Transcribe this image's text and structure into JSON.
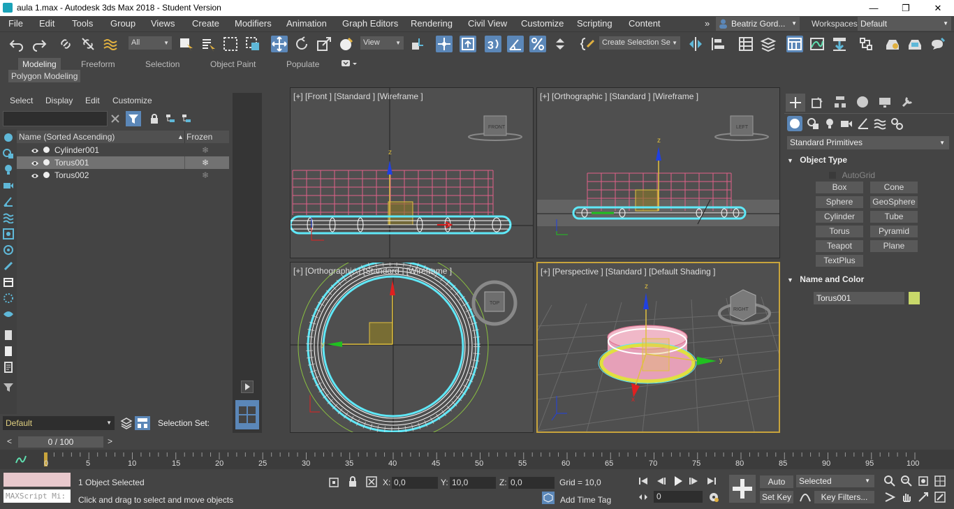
{
  "window": {
    "title": "aula 1.max - Autodesk 3ds Max 2018 - Student Version",
    "minimize": "—",
    "restore": "❐",
    "close": "✕"
  },
  "menu": {
    "items": [
      "File",
      "Edit",
      "Tools",
      "Group",
      "Views",
      "Create",
      "Modifiers",
      "Animation",
      "Graph Editors",
      "Rendering",
      "Civil View",
      "Customize",
      "Scripting",
      "Content"
    ],
    "overflow": "»",
    "user": "Beatriz Gord...",
    "workspaces_label": "Workspaces:",
    "workspace_value": "Default"
  },
  "toolbar": {
    "filter_value": "All",
    "refcoord_value": "View",
    "selection_set_value": "Create Selection Se"
  },
  "ribbon": {
    "tabs": [
      "Modeling",
      "Freeform",
      "Selection",
      "Object Paint",
      "Populate"
    ],
    "sub_label": "Polygon Modeling"
  },
  "explorer": {
    "menus": [
      "Select",
      "Display",
      "Edit",
      "Customize"
    ],
    "col_name": "Name (Sorted Ascending)",
    "col_frozen": "Frozen",
    "sort_arrow": "▲",
    "rows": [
      {
        "name": "Cylinder001",
        "selected": false
      },
      {
        "name": "Torus001",
        "selected": true
      },
      {
        "name": "Torus002",
        "selected": false
      }
    ],
    "layer_value": "Default",
    "selection_set_label": "Selection Set:"
  },
  "viewports": {
    "front": "[+] [Front ] [Standard ] [Wireframe ]",
    "ortho_top_right": "[+] [Orthographic ] [Standard ] [Wireframe ]",
    "ortho_bottom_left": "[+] [Orthographic ] [Standard ] [Wireframe ]",
    "perspective": "[+] [Perspective ] [Standard ] [Default Shading ]",
    "viewcube_front": "FRONT",
    "viewcube_left": "LEFT",
    "viewcube_top": "TOP",
    "viewcube_right": "RIGHT",
    "axis_x": "x",
    "axis_y": "y",
    "axis_z": "z"
  },
  "command_panel": {
    "category_value": "Standard Primitives",
    "object_type_title": "Object Type",
    "autogrid_label": "AutoGrid",
    "buttons": [
      "Box",
      "Cone",
      "Sphere",
      "GeoSphere",
      "Cylinder",
      "Tube",
      "Torus",
      "Pyramid",
      "Teapot",
      "Plane",
      "TextPlus"
    ],
    "name_color_title": "Name and Color",
    "object_name": "Torus001",
    "object_color": "#c8d86a"
  },
  "timeline": {
    "frame_display": "0 / 100",
    "prev": "<",
    "next": ">",
    "ticks": [
      "0",
      "5",
      "10",
      "15",
      "20",
      "25",
      "30",
      "35",
      "40",
      "45",
      "50",
      "55",
      "60",
      "65",
      "70",
      "75",
      "80",
      "85",
      "90",
      "95",
      "100"
    ]
  },
  "status": {
    "maxscript_placeholder": "MAXScript Mi:",
    "objects_selected": "1 Object Selected",
    "prompt": "Click and drag to select and move objects",
    "x_label": "X:",
    "x_value": "0,0",
    "y_label": "Y:",
    "y_value": "10,0",
    "z_label": "Z:",
    "z_value": "0,0",
    "grid": "Grid = 10,0",
    "add_time_tag": "Add Time Tag",
    "auto_key": "Auto Key",
    "set_key": "Set Key",
    "selected_value": "Selected",
    "key_filters": "Key Filters...",
    "frame_value": "0"
  },
  "colors": {
    "accent_blue": "#5b87b8",
    "selection_cyan": "#5fe8f8",
    "grid_pink": "#e0608a",
    "active_vp_border": "#c8a43c"
  }
}
